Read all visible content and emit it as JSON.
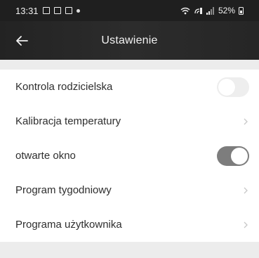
{
  "status_bar": {
    "time": "13:31",
    "battery": "52%",
    "left_icons": [
      "gallery-icon",
      "image-icon",
      "app-icon",
      "dot-icon"
    ],
    "right_icons": [
      "wifi-icon",
      "call-signal-icon",
      "signal-icon",
      "battery-icon"
    ]
  },
  "app_bar": {
    "title": "Ustawienie",
    "back_icon": "arrow-left-icon"
  },
  "settings": [
    {
      "label": "Kontrola rodzicielska",
      "control": "toggle",
      "state": "off"
    },
    {
      "label": "Kalibracja temperatury",
      "control": "chevron"
    },
    {
      "label": "otwarte okno",
      "control": "toggle",
      "state": "on"
    },
    {
      "label": "Program tygodniowy",
      "control": "chevron"
    },
    {
      "label": "Programa użytkownika",
      "control": "chevron"
    }
  ],
  "colors": {
    "header_bg": "#262626",
    "toggle_on": "#7d7d7d",
    "toggle_off": "#eeeeee",
    "page_bg": "#ececec"
  }
}
